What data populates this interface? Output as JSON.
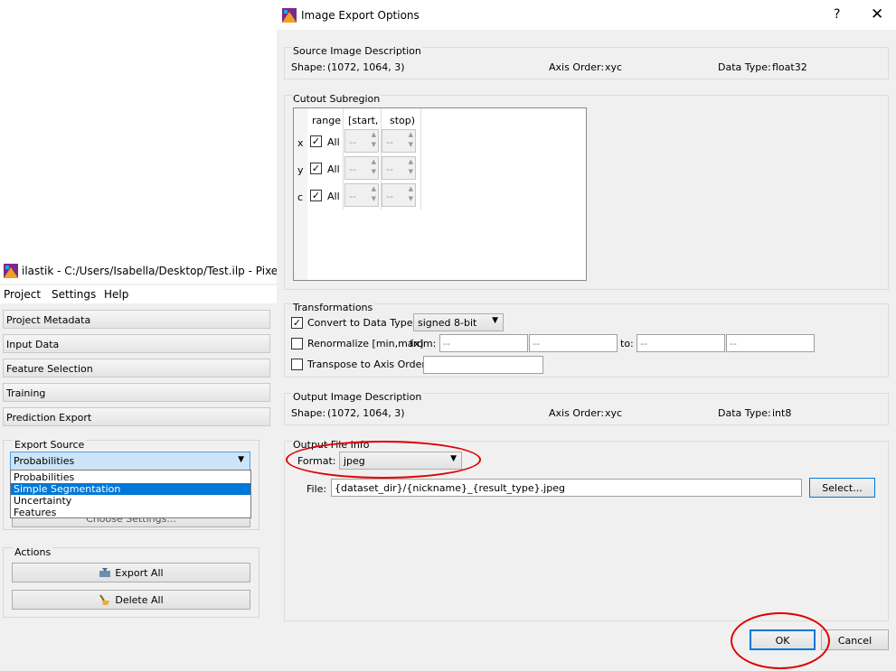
{
  "main_window": {
    "title": "ilastik - C:/Users/Isabella/Desktop/Test.ilp - Pixel Class",
    "menu": [
      "Project",
      "Settings",
      "Help"
    ],
    "applets": [
      "Project Metadata",
      "Input Data",
      "Feature Selection",
      "Training",
      "Prediction Export"
    ],
    "export_source": {
      "label": "Export Source",
      "selected": "Probabilities",
      "options": [
        "Probabilities",
        "Simple Segmentation",
        "Uncertainty",
        "Features"
      ],
      "highlighted_index": 1
    },
    "choose_settings_label": "Choose Settings...",
    "actions": {
      "label": "Actions",
      "export_all": "Export All",
      "delete_all": "Delete All"
    }
  },
  "dialog": {
    "title": "Image Export Options",
    "help_glyph": "?",
    "close_glyph": "✕",
    "source": {
      "label": "Source Image Description",
      "shape_label": "Shape:",
      "shape": "(1072, 1064, 3)",
      "axis_label": "Axis Order:",
      "axis": "xyc",
      "dtype_label": "Data Type:",
      "dtype": "float32"
    },
    "cutout": {
      "label": "Cutout Subregion",
      "headers": [
        "range",
        "[start,",
        "stop)"
      ],
      "rows": [
        {
          "axis": "x",
          "all": "All",
          "start": "--",
          "stop": "--"
        },
        {
          "axis": "y",
          "all": "All",
          "start": "--",
          "stop": "--"
        },
        {
          "axis": "c",
          "all": "All",
          "start": "--",
          "stop": "--"
        }
      ]
    },
    "transformations": {
      "label": "Transformations",
      "convert_label": "Convert to Data Type:",
      "convert_value": "signed 8-bit",
      "renormalize_label": "Renormalize [min,max]",
      "from_label": "from:",
      "to_label": "to:",
      "placeholder": "--",
      "transpose_label": "Transpose to Axis Order:"
    },
    "output": {
      "label": "Output Image Description",
      "shape_label": "Shape:",
      "shape": "(1072, 1064, 3)",
      "axis_label": "Axis Order:",
      "axis": "xyc",
      "dtype_label": "Data Type:",
      "dtype": "int8"
    },
    "file_info": {
      "label": "Output File Info",
      "format_label": "Format:",
      "format_value": "jpeg",
      "file_label": "File:",
      "file_value": "{dataset_dir}/{nickname}_{result_type}.jpeg",
      "select_label": "Select..."
    },
    "ok_label": "OK",
    "cancel_label": "Cancel"
  },
  "colors": {
    "annotation_red": "#e00000",
    "selection_blue": "#0078d7",
    "combo_highlight": "#cce4f7"
  }
}
